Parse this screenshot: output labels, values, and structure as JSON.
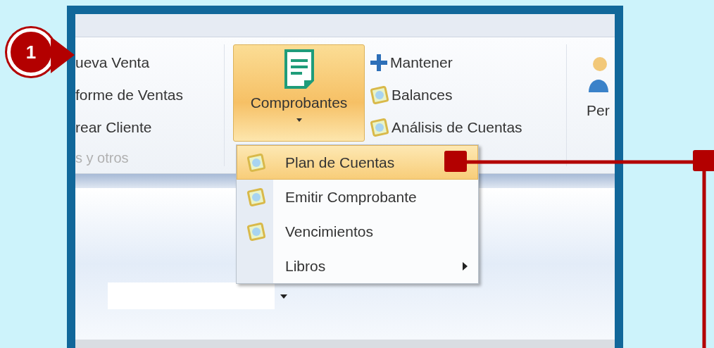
{
  "annotation": {
    "step": "1"
  },
  "left_group": {
    "items": [
      {
        "label": "ueva Venta"
      },
      {
        "label": "forme de Ventas"
      },
      {
        "label": "rear Cliente"
      }
    ],
    "caption": "s y otros"
  },
  "comprobantes_button": {
    "label": "Comprobantes",
    "expanded": true
  },
  "small_items": [
    {
      "label": "Mantener",
      "kind": "plus"
    },
    {
      "label": "Balances",
      "kind": "frame"
    },
    {
      "label": "Análisis de Cuentas",
      "kind": "frame"
    }
  ],
  "right_button": {
    "label": "Per"
  },
  "menu": {
    "items": [
      {
        "label": "Plan de Cuentas",
        "selected": true,
        "kind": "frame"
      },
      {
        "label": "Emitir Comprobante",
        "selected": false,
        "kind": "frame"
      },
      {
        "label": "Vencimientos",
        "selected": false,
        "kind": "frame"
      },
      {
        "label": "Libros",
        "selected": false,
        "kind": "submenu"
      }
    ]
  }
}
